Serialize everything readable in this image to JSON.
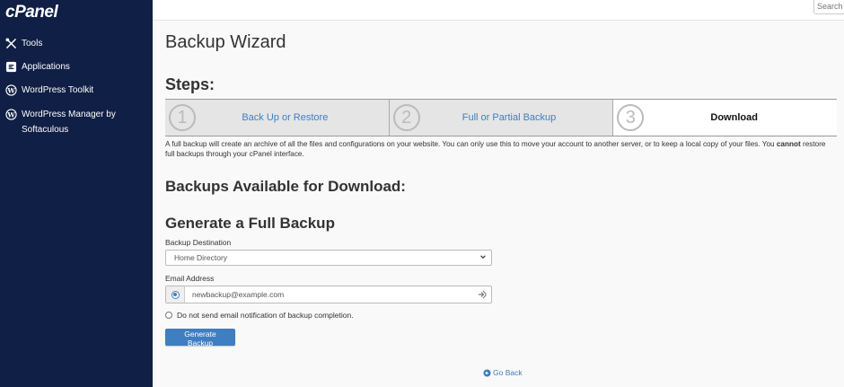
{
  "sidebar": {
    "logo": "cPanel",
    "items": [
      {
        "label": "Tools",
        "icon": "tools-icon"
      },
      {
        "label": "Applications",
        "icon": "applications-icon"
      },
      {
        "label": "WordPress Toolkit",
        "icon": "wordpress-icon"
      },
      {
        "label": "WordPress Manager by Softaculous",
        "icon": "wordpress-icon"
      }
    ]
  },
  "search": {
    "placeholder": "Search"
  },
  "page": {
    "title": "Backup Wizard",
    "steps_heading": "Steps:",
    "steps": [
      {
        "number": "1",
        "label": "Back Up or Restore"
      },
      {
        "number": "2",
        "label": "Full or Partial Backup"
      },
      {
        "number": "3",
        "label": "Download"
      }
    ],
    "description_part1": "A full backup will create an archive of all the files and configurations on your website. You can only use this to move your account to another server, or to keep a local copy of your files. You ",
    "description_bold": "cannot",
    "description_part2": " restore full backups through your cPanel interface.",
    "available_heading": "Backups Available for Download:",
    "generate_heading": "Generate a Full Backup",
    "destination_label": "Backup Destination",
    "destination_value": "Home Directory",
    "email_label": "Email Address",
    "email_value": "newbackup@example.com",
    "no_email_label": "Do not send email notification of backup completion.",
    "generate_button": "Generate Backup",
    "go_back": "Go Back"
  },
  "colors": {
    "sidebar_bg": "#0f1f45",
    "accent": "#3f7ec0"
  }
}
